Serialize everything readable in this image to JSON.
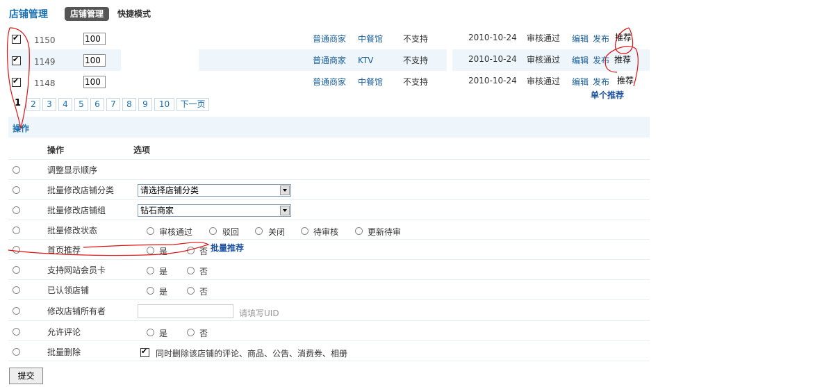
{
  "header": {
    "title": "店铺管理",
    "tabs": [
      {
        "label": "店铺管理"
      },
      {
        "label": "快捷模式"
      }
    ]
  },
  "shops": [
    {
      "checked": true,
      "id": "1150",
      "order": "100",
      "type": "普通商家",
      "category": "中餐馆",
      "support": "不支持",
      "date": "2010-10-24",
      "status": "审核通过",
      "edit": "编辑",
      "publish": "发布",
      "recommend": "推荐"
    },
    {
      "checked": true,
      "id": "1149",
      "order": "100",
      "type": "普通商家",
      "category": "KTV",
      "support": "不支持",
      "date": "2010-10-24",
      "status": "审核通过",
      "edit": "编辑",
      "publish": "发布",
      "recommend": "推荐"
    },
    {
      "checked": true,
      "id": "1148",
      "order": "100",
      "type": "普通商家",
      "category": "中餐馆",
      "support": "不支持",
      "date": "2010-10-24",
      "status": "审核通过",
      "edit": "编辑",
      "publish": "发布",
      "recommend": "推荐"
    }
  ],
  "annotations": {
    "single_recommend": "单个推荐",
    "batch_recommend": "批量推荐"
  },
  "pager": {
    "current": "1",
    "pages": [
      "2",
      "3",
      "4",
      "5",
      "6",
      "7",
      "8",
      "9",
      "10"
    ],
    "next": "下一页"
  },
  "operations": {
    "section_title": "操作",
    "col_action": "操作",
    "col_option": "选项",
    "rows": {
      "reorder": "调整显示顺序",
      "category": "批量修改店铺分类",
      "group": "批量修改店铺组",
      "status": "批量修改状态",
      "homepage": "首页推荐",
      "membercard": "支持网站会员卡",
      "claimed": "已认领店铺",
      "owner": "修改店铺所有者",
      "comments": "允许评论",
      "delete": "批量删除"
    },
    "category_select": "请选择店铺分类",
    "group_select": "钻石商家",
    "status_options": [
      "审核通过",
      "驳回",
      "关闭",
      "待审核",
      "更新待审"
    ],
    "yes": "是",
    "no": "否",
    "uid_hint": "请填写UID",
    "delete_note": "同时删除该店铺的评论、商品、公告、消费券、相册"
  },
  "submit_label": "提交"
}
